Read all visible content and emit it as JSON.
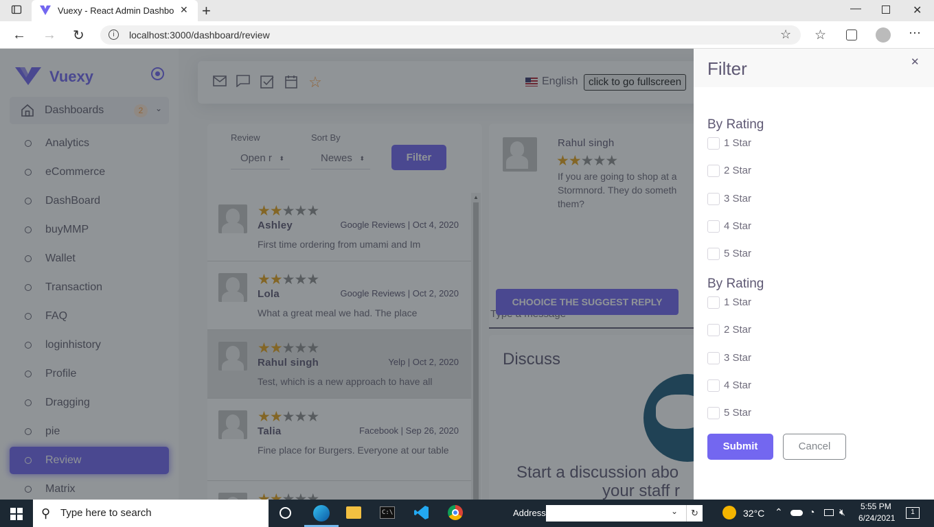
{
  "browser": {
    "tab_title": "Vuexy - React Admin Dashboard",
    "url": "localhost:3000/dashboard/review"
  },
  "sidebar": {
    "brand": "Vuexy",
    "dashboards_label": "Dashboards",
    "dashboards_badge": "2",
    "items": [
      {
        "label": "Analytics"
      },
      {
        "label": "eCommerce"
      },
      {
        "label": "DashBoard"
      },
      {
        "label": "buyMMP"
      },
      {
        "label": "Wallet"
      },
      {
        "label": "Transaction"
      },
      {
        "label": "FAQ"
      },
      {
        "label": "loginhistory"
      },
      {
        "label": "Profile"
      },
      {
        "label": "Dragging"
      },
      {
        "label": "pie"
      },
      {
        "label": "Review"
      },
      {
        "label": "Matrix"
      }
    ]
  },
  "topnav": {
    "language": "English",
    "fullscreen": "click to go fullscreen"
  },
  "review_filters": {
    "review_label": "Review",
    "review_value": "Open r",
    "sort_label": "Sort By",
    "sort_value": "Newes",
    "filter_button": "Filter"
  },
  "reviews": [
    {
      "name": "Ashley",
      "source": "Google Reviews | Oct 4, 2020",
      "text": "First time ordering from umami and Im",
      "stars": 2
    },
    {
      "name": "Lola",
      "source": "Google Reviews | Oct 2, 2020",
      "text": "What a great meal we had. The place",
      "stars": 2
    },
    {
      "name": "Rahul singh",
      "source": "Yelp | Oct 2, 2020",
      "text": "Test, which is a new approach to have all",
      "stars": 2
    },
    {
      "name": "Talia",
      "source": "Facebook | Sep 26, 2020",
      "text": "Fine place for Burgers. Everyone at our table",
      "stars": 2
    }
  ],
  "detail": {
    "name": "Rahul singh",
    "stars": 2,
    "text": "If you are going to shop at a Stormnord. They do someth them?",
    "message_placeholder": "Type a message",
    "suggest_button": "CHOOICE THE SUGGEST REPLY"
  },
  "discuss": {
    "title": "Discuss",
    "line1": "Start a discussion abo",
    "line2": "your staff r"
  },
  "filter_panel": {
    "title": "Filter",
    "section1_title": "By Rating",
    "section1_options": [
      "1 Star",
      "2 Star",
      "3 Star",
      "4 Star",
      "5 Star"
    ],
    "section2_title": "By Rating",
    "section2_options": [
      "1 Star",
      "2 Star",
      "3 Star",
      "4 Star",
      "5 Star"
    ],
    "submit": "Submit",
    "cancel": "Cancel"
  },
  "taskbar": {
    "search_placeholder": "Type here to search",
    "address_label": "Address",
    "temperature": "32°C",
    "time": "5:55 PM",
    "date": "6/24/2021"
  },
  "colors": {
    "primary": "#7367f0",
    "star": "#e5a21d",
    "badge": "#ff9f43"
  }
}
